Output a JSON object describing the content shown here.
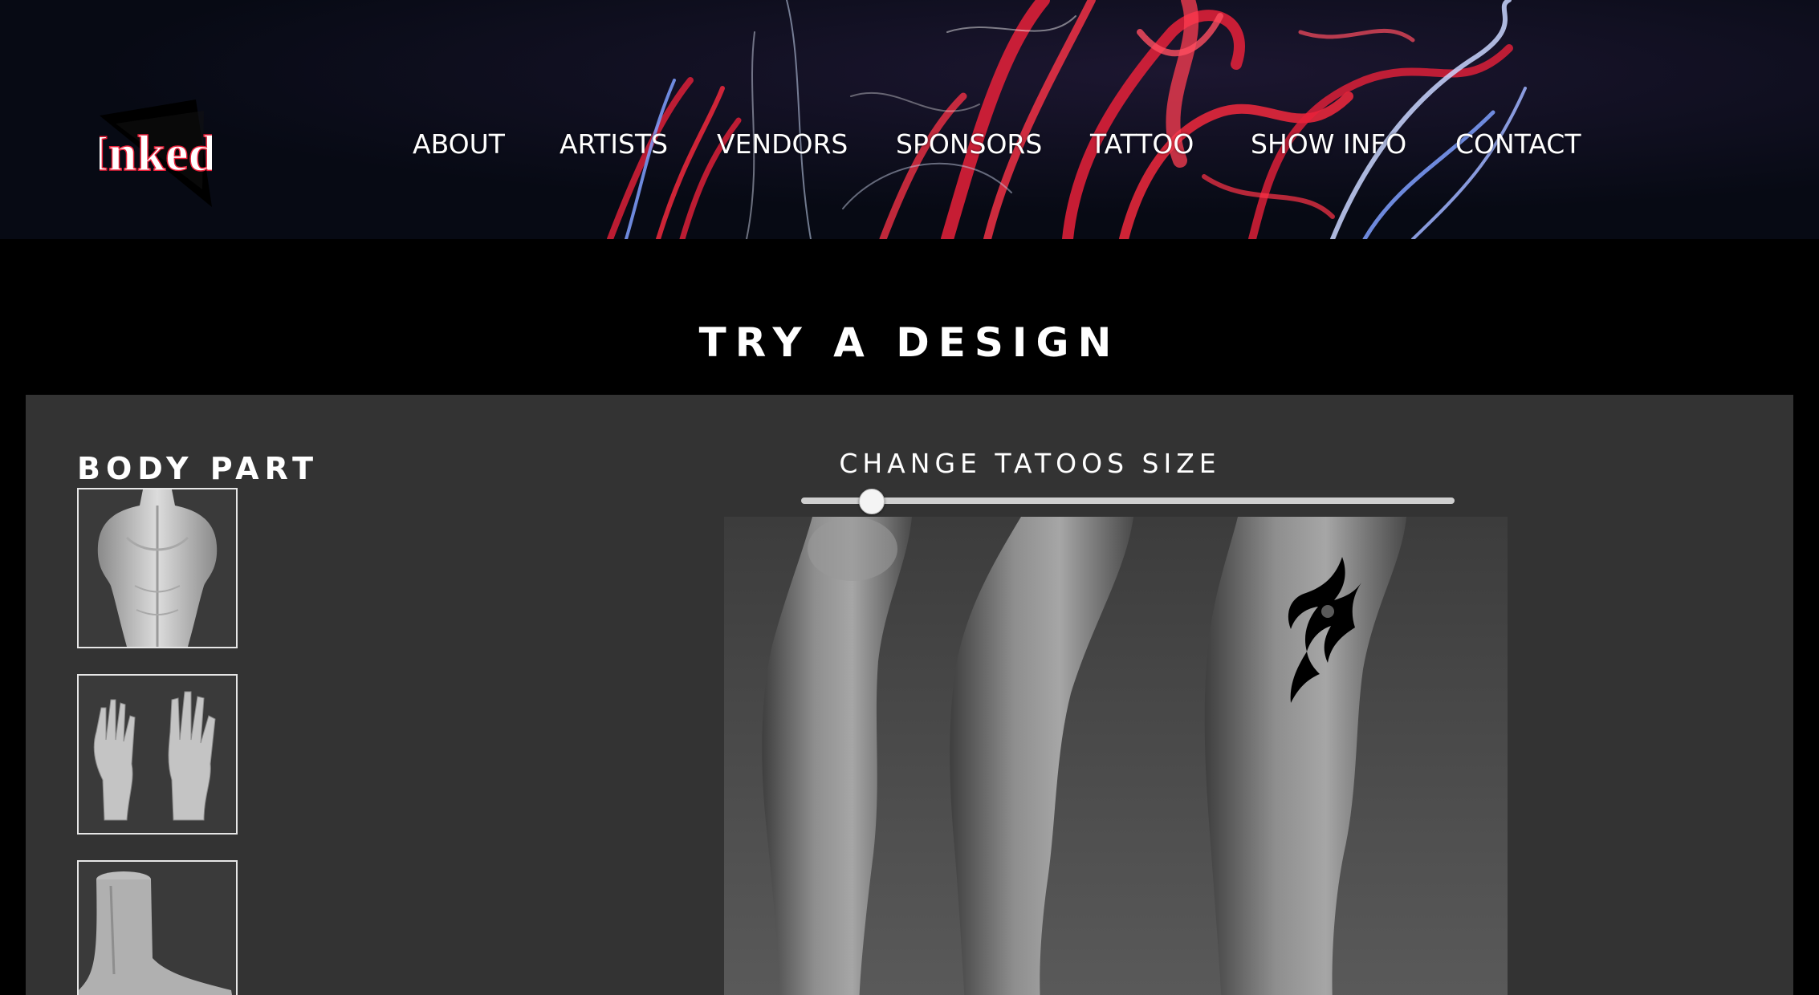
{
  "header": {
    "logo_text": "Inked",
    "nav": [
      {
        "label": "ABOUT"
      },
      {
        "label": "ARTISTS"
      },
      {
        "label": "VENDORS"
      },
      {
        "label": "SPONSORS"
      },
      {
        "label": "TATTOO"
      },
      {
        "label": "SHOW INFO"
      },
      {
        "label": "CONTACT"
      }
    ]
  },
  "main": {
    "title": "TRY A DESIGN",
    "body_part": {
      "label": "BODY PART",
      "options": [
        "back",
        "hands",
        "foot"
      ]
    },
    "size_control": {
      "label": "CHANGE TATOOS SIZE",
      "value_fraction": 0.1
    }
  },
  "colors": {
    "page_bg": "#000000",
    "panel_bg": "#333333",
    "accent_red": "#e8213a",
    "accent_blue": "#7fa0ff"
  }
}
